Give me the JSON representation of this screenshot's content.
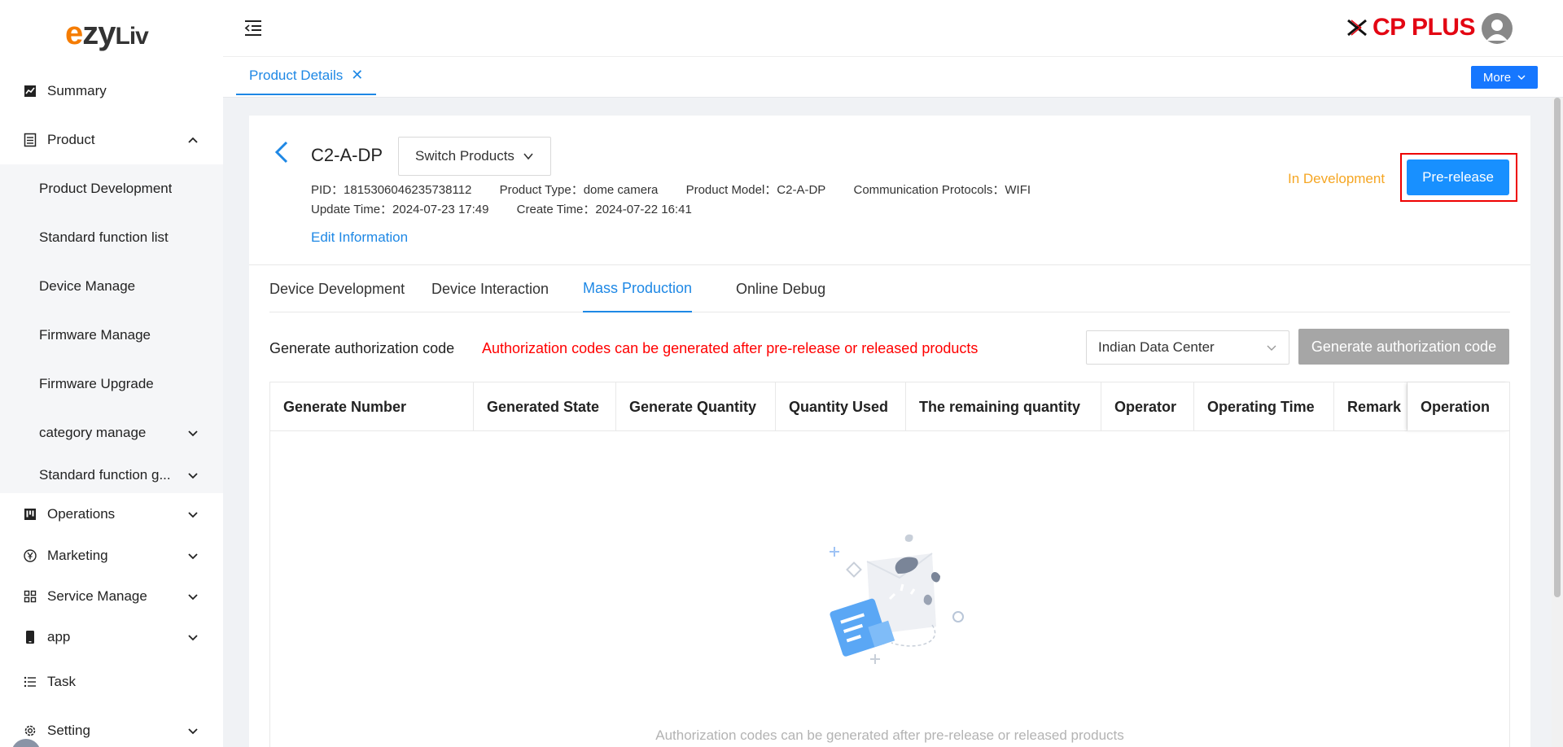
{
  "app": {
    "logo_text_e": "e",
    "logo_text_zy": "zy",
    "logo_text_liv": "Liv",
    "brand": "CP PLUS"
  },
  "sidebar": {
    "items": [
      {
        "label": "Summary",
        "icon": "chart-icon"
      },
      {
        "label": "Product",
        "icon": "document-icon",
        "expanded": true
      },
      {
        "label": "Operations",
        "icon": "kanban-icon"
      },
      {
        "label": "Marketing",
        "icon": "yen-circle-icon"
      },
      {
        "label": "Service Manage",
        "icon": "grid-icon"
      },
      {
        "label": "app",
        "icon": "phone-icon"
      },
      {
        "label": "Task",
        "icon": "list-icon"
      },
      {
        "label": "Setting",
        "icon": "gear-icon"
      }
    ],
    "product_sub": [
      {
        "label": "Product Development"
      },
      {
        "label": "Standard function list"
      },
      {
        "label": "Device Manage"
      },
      {
        "label": "Firmware Manage"
      },
      {
        "label": "Firmware Upgrade"
      },
      {
        "label": "category manage"
      },
      {
        "label": "Standard function g..."
      }
    ]
  },
  "tabbar": {
    "page_tab": "Product Details",
    "close": "✕",
    "more": "More"
  },
  "product": {
    "name": "C2-A-DP",
    "switch_label": "Switch Products",
    "pid": "PID：1815306046235738112",
    "type": "Product Type：dome camera",
    "model": "Product Model：C2-A-DP",
    "protocols": "Communication Protocols：WIFI",
    "update_time": "Update Time：2024-07-23 17:49",
    "create_time": "Create Time：2024-07-22 16:41",
    "edit": "Edit Information",
    "status": "In Development",
    "prerelease": "Pre-release"
  },
  "tabs": [
    {
      "label": "Device Development",
      "active": false
    },
    {
      "label": "Device Interaction",
      "active": false
    },
    {
      "label": "Mass Production",
      "active": true
    },
    {
      "label": "Online Debug",
      "active": false
    }
  ],
  "auth": {
    "title": "Generate authorization code",
    "warning": "Authorization codes can be generated after pre-release or released products",
    "data_center": "Indian Data Center",
    "generate_btn": "Generate authorization code"
  },
  "table": {
    "columns": [
      "Generate Number",
      "Generated State",
      "Generate Quantity",
      "Quantity Used",
      "The remaining quantity",
      "Operator",
      "Operating Time",
      "Remark",
      "Operation"
    ],
    "rows": [],
    "empty_text": "Authorization codes can be generated after pre-release or released products"
  },
  "colors": {
    "accent": "#1e88e5",
    "primary_button": "#1890ff",
    "status": "#f5a623",
    "warning": "#ff0000",
    "disabled_button": "#a6a6a6",
    "brand_red": "#e30613"
  }
}
